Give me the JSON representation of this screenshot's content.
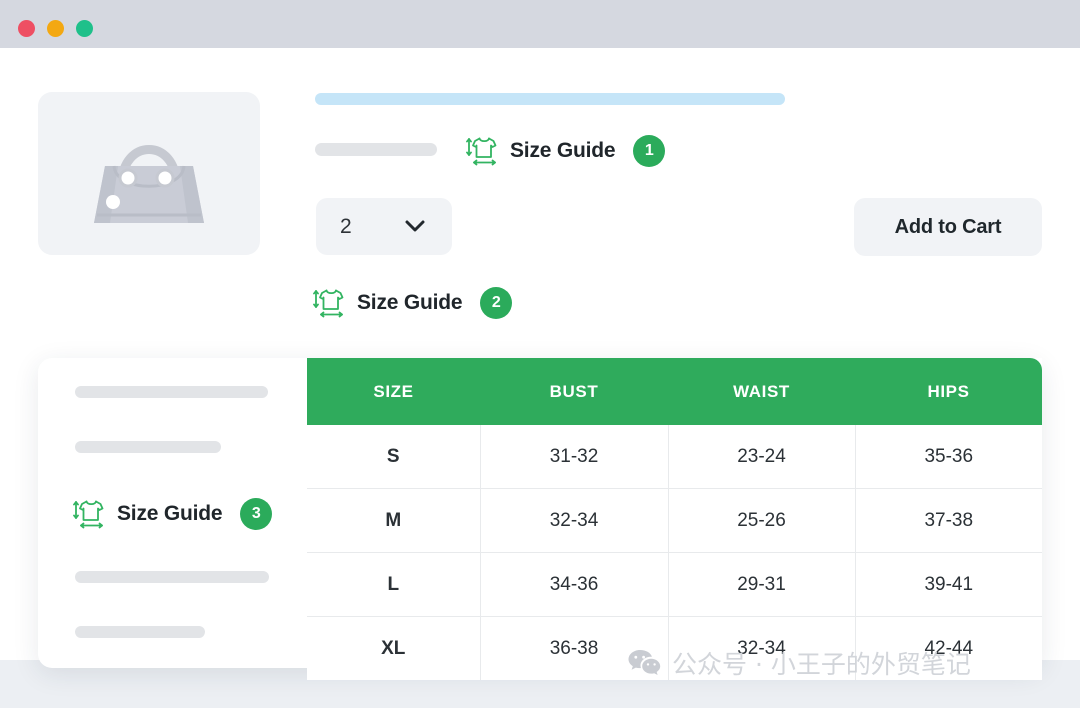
{
  "window": {
    "traffic_lights": [
      {
        "name": "close",
        "color": "#ee4f63"
      },
      {
        "name": "minimize",
        "color": "#f3a812"
      },
      {
        "name": "maximize",
        "color": "#1fc08a"
      }
    ]
  },
  "product": {
    "image_alt": "handbag-illustration",
    "title_placeholder": "",
    "size_guide_link_1": {
      "label": "Size Guide",
      "badge": "1",
      "icon": "size-guide-tshirt-icon"
    },
    "quantity": {
      "value": "2",
      "caret_icon": "chevron-down-icon"
    },
    "add_to_cart_label": "Add to Cart",
    "size_guide_link_2": {
      "label": "Size Guide",
      "badge": "2",
      "icon": "size-guide-tshirt-icon"
    }
  },
  "guide_card": {
    "size_guide_link_3": {
      "label": "Size Guide",
      "badge": "3",
      "icon": "size-guide-tshirt-icon"
    }
  },
  "size_table": {
    "headers": [
      "SIZE",
      "BUST",
      "WAIST",
      "HIPS"
    ],
    "rows": [
      {
        "size": "S",
        "bust": "31-32",
        "waist": "23-24",
        "hips": "35-36"
      },
      {
        "size": "M",
        "bust": "32-34",
        "waist": "25-26",
        "hips": "37-38"
      },
      {
        "size": "L",
        "bust": "34-36",
        "waist": "29-31",
        "hips": "39-41"
      },
      {
        "size": "XL",
        "bust": "36-38",
        "waist": "32-34",
        "hips": "42-44"
      }
    ]
  },
  "watermark": {
    "text": "公众号 · 小王子的外贸笔记",
    "icon": "wechat-icon"
  },
  "colors": {
    "brand_green": "#2fab5c",
    "badge_green": "#2bab5b",
    "titlebar": "#d5d8e0",
    "skeleton": "#e2e4e7",
    "skeleton_accent": "#c5e5f8",
    "surface_muted": "#f1f3f6"
  }
}
